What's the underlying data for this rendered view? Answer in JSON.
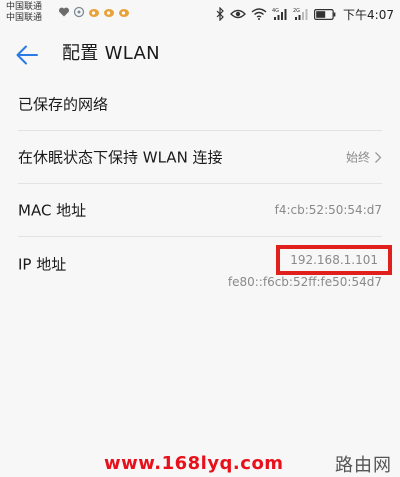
{
  "status_bar": {
    "carriers": [
      "中国联通",
      "中国联通"
    ],
    "time": "下午4:07",
    "battery_icon": "battery-icon",
    "wifi_icon": "wifi-icon",
    "signal_icons": [
      "signal-4g-icon",
      "signal-2g-icon"
    ],
    "bluetooth_icon": "bluetooth-icon",
    "eye_icon": "eye-comfort-icon"
  },
  "app_bar": {
    "title": "配置 WLAN",
    "back_icon": "back-arrow-icon",
    "accent_color": "#2a7be4"
  },
  "settings": {
    "saved_networks": {
      "label": "已保存的网络"
    },
    "keep_wlan_sleep": {
      "label": "在休眠状态下保持 WLAN 连接",
      "value": "始终"
    },
    "mac_address": {
      "label": "MAC 地址",
      "value": "f4:cb:52:50:54:d7"
    },
    "ip_address": {
      "label": "IP 地址",
      "ipv4": "192.168.1.101",
      "ipv6": "fe80::f6cb:52ff:fe50:54d7",
      "highlight_color": "#e0201c"
    }
  },
  "watermark": {
    "url": "www.168lyq.com",
    "brand": "路由网",
    "url_color": "#e8101a"
  }
}
